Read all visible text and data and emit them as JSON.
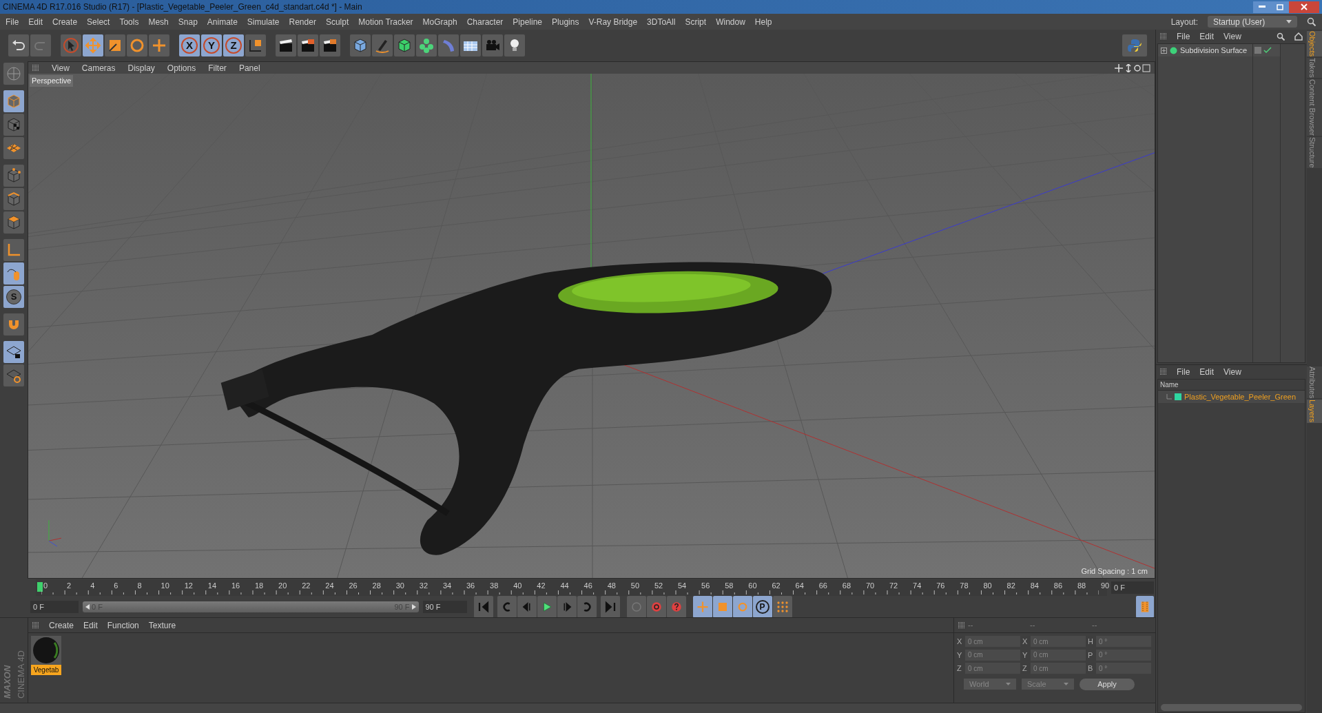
{
  "window": {
    "title": "CINEMA 4D R17.016 Studio (R17) - [Plastic_Vegetable_Peeler_Green_c4d_standart.c4d *] - Main"
  },
  "menu": [
    "File",
    "Edit",
    "Create",
    "Select",
    "Tools",
    "Mesh",
    "Snap",
    "Animate",
    "Simulate",
    "Render",
    "Sculpt",
    "Motion Tracker",
    "MoGraph",
    "Character",
    "Pipeline",
    "Plugins",
    "V-Ray Bridge",
    "3DToAll",
    "Script",
    "Window",
    "Help"
  ],
  "layout": {
    "label": "Layout:",
    "value": "Startup (User)"
  },
  "toolbar": {
    "axis_locks": [
      {
        "label": "X",
        "selected": true
      },
      {
        "label": "Y",
        "selected": true
      },
      {
        "label": "Z",
        "selected": true
      }
    ]
  },
  "left_toolbar": {
    "snap_label": "S"
  },
  "viewport": {
    "menu": [
      "View",
      "Cameras",
      "Display",
      "Options",
      "Filter",
      "Panel"
    ],
    "camera": "Perspective",
    "grid_spacing": "Grid Spacing : 1 cm"
  },
  "timeline": {
    "ticks": [
      "0",
      "2",
      "4",
      "6",
      "8",
      "10",
      "12",
      "14",
      "16",
      "18",
      "20",
      "22",
      "24",
      "26",
      "28",
      "30",
      "32",
      "34",
      "36",
      "38",
      "40",
      "42",
      "44",
      "46",
      "48",
      "50",
      "52",
      "54",
      "56",
      "58",
      "60",
      "62",
      "64",
      "66",
      "68",
      "70",
      "72",
      "74",
      "76",
      "78",
      "80",
      "82",
      "84",
      "86",
      "88",
      "90"
    ],
    "current_frame": "0 F",
    "start": "0 F",
    "range_start": "0 F",
    "range_end": "90 F",
    "range": {
      "level": 1
    },
    "end": "90 F"
  },
  "transform_modes": [
    {
      "kind": "move",
      "selected": true
    },
    {
      "kind": "scale",
      "selected": true
    },
    {
      "kind": "rotate",
      "selected": true
    },
    {
      "kind": "param",
      "label": "P",
      "selected": true
    }
  ],
  "materials": {
    "menu": [
      "Create",
      "Edit",
      "Function",
      "Texture"
    ],
    "items": [
      {
        "name": "Vegetab",
        "selected": true
      }
    ]
  },
  "coordinates": {
    "headers": [
      "--",
      "--",
      "--"
    ],
    "rows": [
      {
        "a": "X",
        "a_value": "0 cm",
        "b": "X",
        "b_value": "0 cm",
        "c": "H",
        "c_value": "0 °"
      },
      {
        "a": "Y",
        "a_value": "0 cm",
        "b": "Y",
        "b_value": "0 cm",
        "c": "P",
        "c_value": "0 °"
      },
      {
        "a": "Z",
        "a_value": "0 cm",
        "b": "Z",
        "b_value": "0 cm",
        "c": "B",
        "c_value": "0 °"
      }
    ],
    "space": "World",
    "mode": "Scale",
    "apply": "Apply"
  },
  "objects_panel": {
    "menu": [
      "File",
      "Edit",
      "View"
    ],
    "objects": [
      {
        "name": "Subdivision Surface",
        "enabled": true
      }
    ]
  },
  "layers_panel": {
    "menu": [
      "File",
      "Edit",
      "View"
    ],
    "column": "Name",
    "layers": [
      {
        "name": "Plastic_Vegetable_Peeler_Green",
        "color": "#2ed6a0"
      }
    ]
  },
  "side_tabs_top": [
    {
      "label": "Objects",
      "selected": true
    },
    {
      "label": "Takes",
      "selected": false
    },
    {
      "label": "Content Browser",
      "selected": false
    },
    {
      "label": "Structure",
      "selected": false
    }
  ],
  "side_tabs_bottom": [
    {
      "label": "Attributes",
      "selected": false
    },
    {
      "label": "Layers",
      "selected": true
    }
  ],
  "branding": {
    "maker": "MAXON",
    "product": "CINEMA 4D"
  }
}
